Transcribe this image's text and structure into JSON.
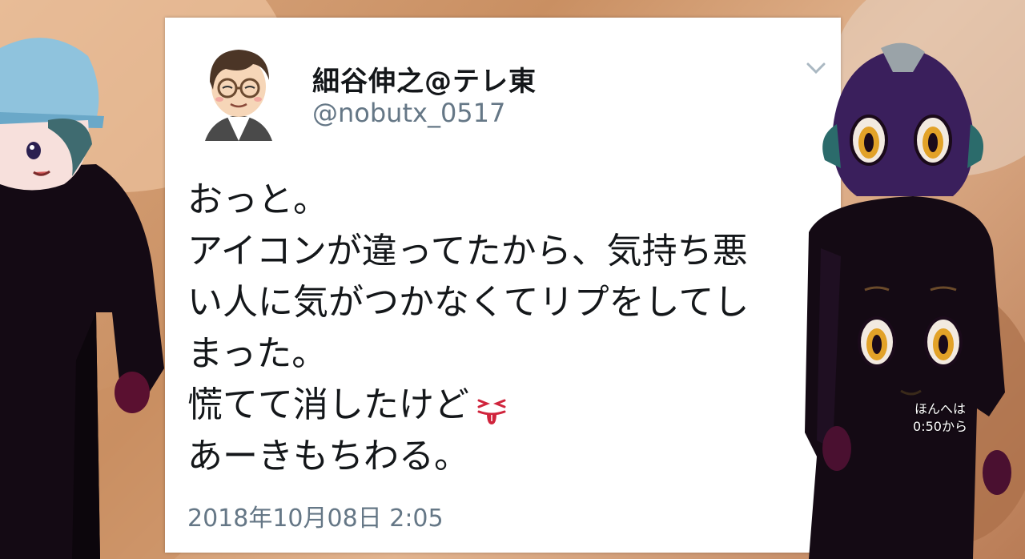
{
  "tweet": {
    "display_name": "細谷伸之@テレ東",
    "handle": "@nobutx_0517",
    "lines": [
      "おっと。",
      "アイコンが違ってたから、気持ち悪",
      "い人に気がつかなくてリプをしてし",
      "まった。",
      "慌てて消したけど",
      "あーきもちわる。"
    ],
    "emoji": "tongue-out-face",
    "timestamp": "2018年10月08日 2:05",
    "icons": {
      "avatar": "avatar-glasses-man",
      "menu": "chevron-down-icon"
    }
  },
  "overlay": {
    "line1": "ほんへは",
    "line2": "0:50から"
  },
  "colors": {
    "card_bg": "#ffffff",
    "text_primary": "#14171a",
    "text_secondary": "#657786",
    "character_body": "#140a14",
    "accent_purple": "#3a1f5c"
  }
}
